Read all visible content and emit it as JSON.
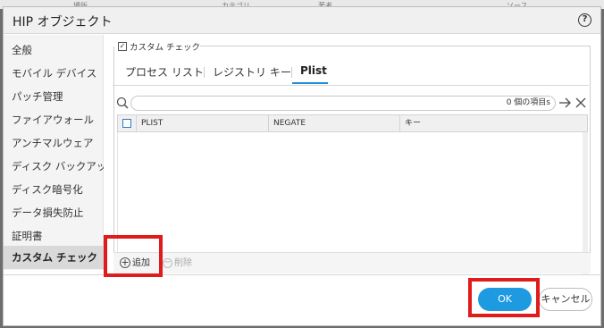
{
  "background": {
    "columns": [
      "場所",
      "カテゴリ",
      "著者",
      "ソース"
    ]
  },
  "dialog": {
    "title": "HIP オブジェクト",
    "help_icon": "help-circle-icon"
  },
  "sidebar": {
    "items": [
      {
        "label": "全般",
        "active": false
      },
      {
        "label": "モバイル デバイス",
        "active": false
      },
      {
        "label": "パッチ管理",
        "active": false
      },
      {
        "label": "ファイアウォール",
        "active": false
      },
      {
        "label": "アンチマルウェア",
        "active": false
      },
      {
        "label": "ディスク バックアップ",
        "active": false
      },
      {
        "label": "ディスク暗号化",
        "active": false
      },
      {
        "label": "データ損失防止",
        "active": false
      },
      {
        "label": "証明書",
        "active": false
      },
      {
        "label": "カスタム チェック",
        "active": true
      }
    ]
  },
  "section": {
    "checkbox_checked": true,
    "title": "カスタム チェック"
  },
  "tabs": [
    {
      "label": "プロセス リスト",
      "active": false
    },
    {
      "label": "レジストリ キー",
      "active": false
    },
    {
      "label": "Plist",
      "active": true
    }
  ],
  "search": {
    "value": "",
    "count_text": "0 個の項目s"
  },
  "table": {
    "columns": [
      "PLIST",
      "NEGATE",
      "キー"
    ],
    "rows": []
  },
  "actions": {
    "add_label": "追加",
    "delete_label": "削除"
  },
  "footer": {
    "ok_label": "OK",
    "cancel_label": "キャンセル"
  },
  "colors": {
    "accent": "#1e9ae0",
    "highlight": "#e01b1b"
  }
}
